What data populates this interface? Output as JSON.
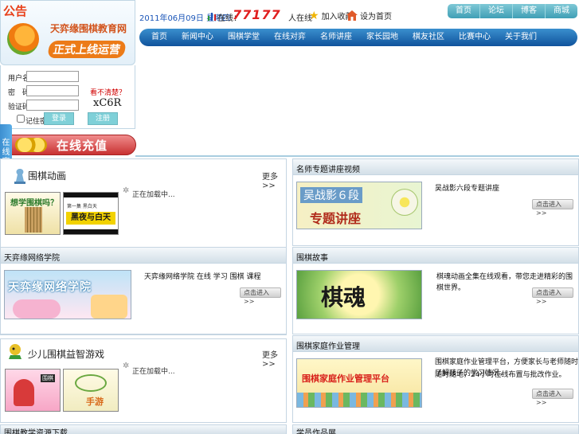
{
  "notice": {
    "tag": "公告",
    "line1": "天弈缘围棋教育网",
    "line2": "正式上线运营"
  },
  "login": {
    "username_label": "用户名：",
    "password_label": "密　码：",
    "captcha_label": "验证码：",
    "captcha_hint": "看不清楚？",
    "captcha_code": "xC6R",
    "remember_label": "记住密码",
    "login_button": "登录",
    "register_button": "注册"
  },
  "recharge": {
    "label": "在线充值"
  },
  "side_tab": {
    "label": "在线客服"
  },
  "header": {
    "date": "2011年06月09日 星期四",
    "online_label": "在线：",
    "online_count": "77177",
    "online_unit": "人在线",
    "favorite_label": "加入收藏",
    "home_label": "设为首页",
    "top_tabs": [
      "首页",
      "论坛",
      "博客",
      "商城"
    ]
  },
  "nav": {
    "items": [
      "首页",
      "新闻中心",
      "围棋学堂",
      "在线对弈",
      "名师讲座",
      "家长园地",
      "棋友社区",
      "比赛中心",
      "关于我们"
    ]
  },
  "panels": {
    "p1": {
      "title": "围棋动画",
      "more": "更多>>",
      "thumb1_label": "想学围棋吗？",
      "thumb2_label_top": "第一集 黑白天",
      "thumb2_label": "黑夜与白天",
      "loading": "正在加载中..."
    },
    "p2": {
      "title": "名师专题讲座视频",
      "banner_label": "吴战影６段",
      "banner_sub": "专题讲座",
      "desc": "吴战影六段专题讲座",
      "enter": "点击进入 >>"
    },
    "p3": {
      "title": "天弈缘网络学院",
      "banner_label": "天弈缘网络学院",
      "desc": "天弈缘网络学院 在线 学习 围棋 课程",
      "enter": "点击进入 >>"
    },
    "p4": {
      "title": "围棋故事",
      "banner_label": "棋魂",
      "desc": "棋魂动画全集在线观看，带您走进精彩的围棋世界。",
      "enter": "点击进入 >>"
    },
    "p5": {
      "title": "少儿围棋益智游戏",
      "more": "更多>>",
      "thumb1_label": "围棋",
      "thumb2_label": "手游",
      "loading": "正在加载中..."
    },
    "p6": {
      "title": "围棋家庭作业管理",
      "banner_label": "围棋家庭作业管理平台",
      "desc_line1": "围棋家庭作业管理平台，方便家长与老师随时了解孩子的学习情况，",
      "desc_line2": "随时随地，24小时在线布置与批改作业。",
      "enter": "点击进入 >>"
    },
    "p7": {
      "title": "围棋教学资源下载"
    },
    "p8": {
      "title": "学员作品展"
    }
  }
}
